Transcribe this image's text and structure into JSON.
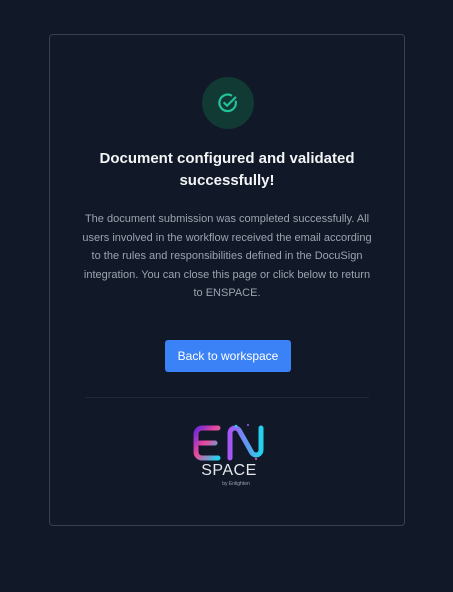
{
  "dialog": {
    "title": "Document configured and validated successfully!",
    "message": "The document submission was completed successfully. All users involved in the workflow received the email according to the rules and responsibilities defined in the DocuSign integration. You can close this page or click below to return to ENSPACE.",
    "button_label": "Back to workspace"
  },
  "logo": {
    "top_text": "EN",
    "bottom_text": "SPACE",
    "tagline": "by Enlighten"
  },
  "colors": {
    "background": "#111827",
    "accent": "#3b82f6",
    "success": "#10b981",
    "logo_gradient_start": "#6d28d9",
    "logo_gradient_mid": "#ec4899",
    "logo_gradient_end": "#22d3ee"
  },
  "icons": {
    "status": "check-circle-icon"
  }
}
